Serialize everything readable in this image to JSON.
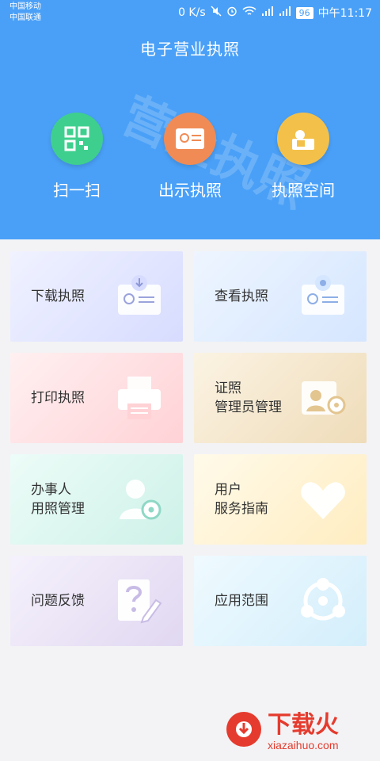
{
  "status": {
    "carrier1": "中国移动",
    "carrier2": "中国联通",
    "speed": "0 K/s",
    "battery": "96",
    "time": "中午11:17"
  },
  "header": {
    "title": "电子营业执照",
    "watermark": "营业执照"
  },
  "quick_actions": [
    {
      "label": "扫一扫",
      "color": "#3ecf8e",
      "icon": "qr-code-icon"
    },
    {
      "label": "出示执照",
      "color": "#f08b55",
      "icon": "license-card-icon"
    },
    {
      "label": "执照空间",
      "color": "#f3c14a",
      "icon": "person-card-icon"
    }
  ],
  "tiles": [
    {
      "label1": "下载执照",
      "label2": "",
      "bg": "#e4e8ff",
      "icon": "download-license-icon"
    },
    {
      "label1": "查看执照",
      "label2": "",
      "bg": "#e2ecff",
      "icon": "view-license-icon"
    },
    {
      "label1": "打印执照",
      "label2": "",
      "bg": "#ffe1e3",
      "icon": "printer-icon"
    },
    {
      "label1": "证照",
      "label2": "管理员管理",
      "bg": "#f4e6cf",
      "icon": "admin-management-icon"
    },
    {
      "label1": "办事人",
      "label2": "用照管理",
      "bg": "#ddf7f1",
      "icon": "person-gear-icon"
    },
    {
      "label1": "用户",
      "label2": "服务指南",
      "bg": "#fff2cf",
      "icon": "heart-icon"
    },
    {
      "label1": "问题反馈",
      "label2": "",
      "bg": "#ebe4f7",
      "icon": "feedback-icon"
    },
    {
      "label1": "应用范围",
      "label2": "",
      "bg": "#dff3fb",
      "icon": "share-scope-icon"
    }
  ],
  "brand": {
    "name": "下载火",
    "url": "xiazaihuo.com"
  }
}
